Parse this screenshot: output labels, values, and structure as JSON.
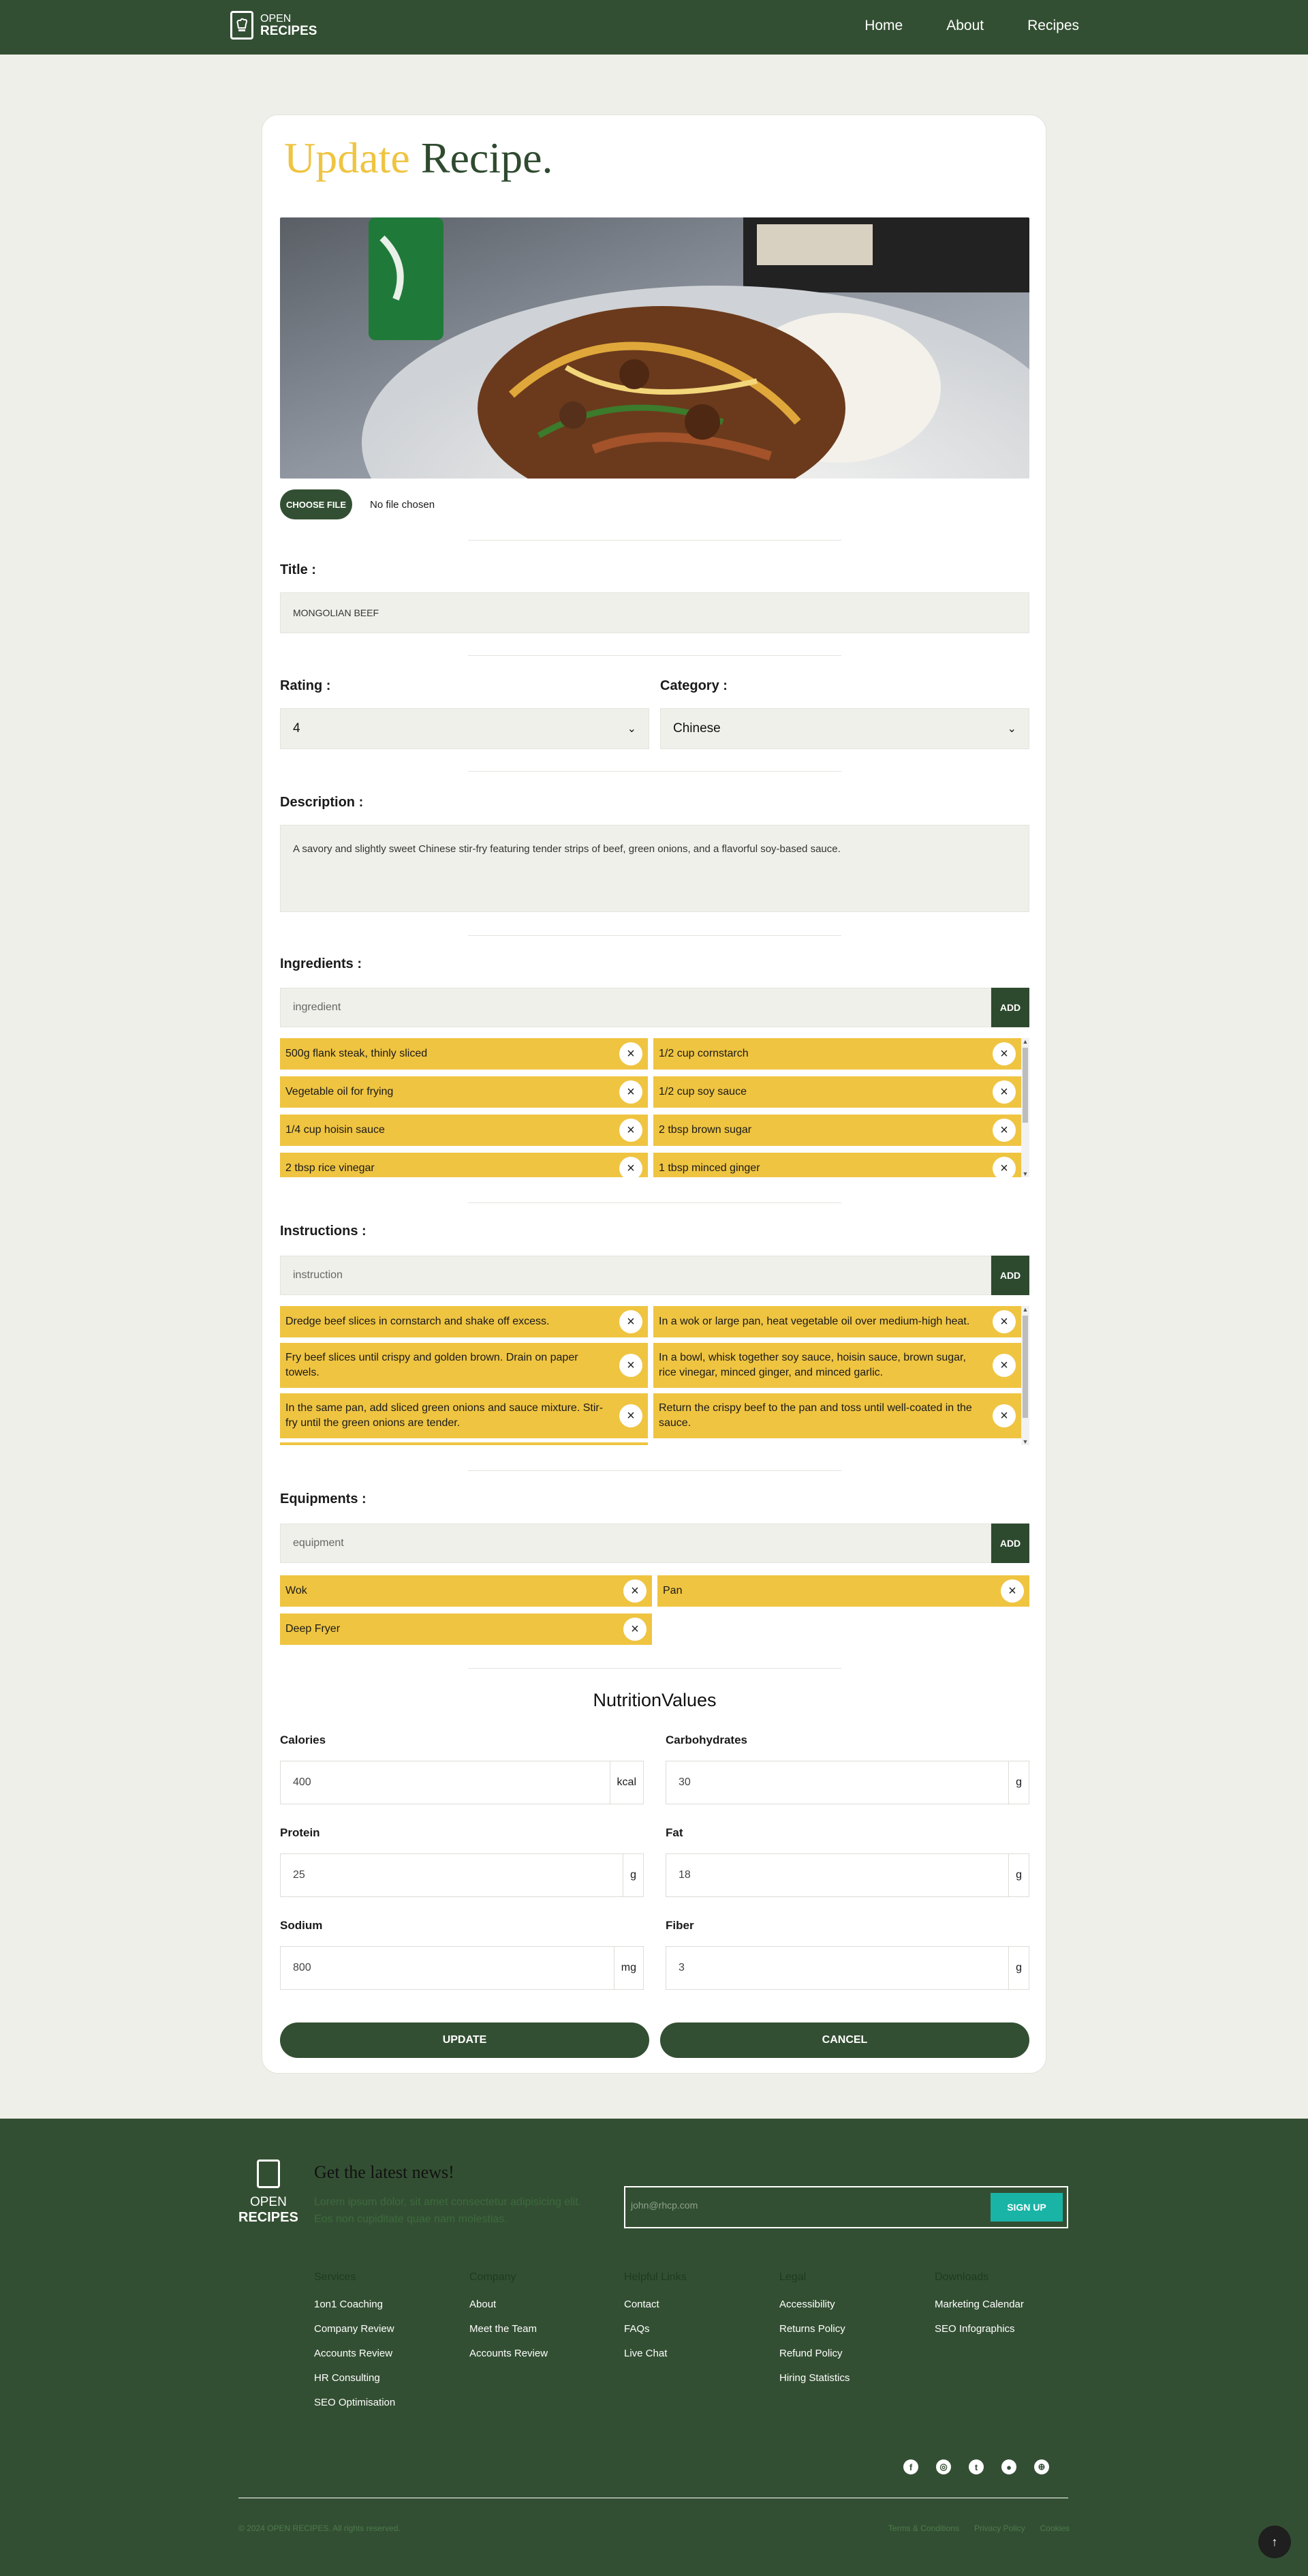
{
  "brand": {
    "line1": "OPEN",
    "line2": "RECIPES"
  },
  "nav": {
    "items": [
      "Home",
      "About",
      "Recipes"
    ]
  },
  "heading": {
    "word1": "Update",
    "word2": "Recipe."
  },
  "file": {
    "button_label": "CHOOSE FILE",
    "status": "No file chosen"
  },
  "title_field": {
    "label": "Title :",
    "value": "MONGOLIAN BEEF"
  },
  "rating": {
    "label": "Rating :",
    "value": "4"
  },
  "category": {
    "label": "Category :",
    "value": "Chinese"
  },
  "description": {
    "label": "Description :",
    "value": "A savory and slightly sweet Chinese stir-fry featuring tender strips of beef, green onions, and a flavorful soy-based sauce."
  },
  "ingredients": {
    "label": "Ingredients :",
    "placeholder": "ingredient",
    "add_label": "ADD",
    "items": [
      "500g flank steak, thinly sliced",
      "1/2 cup cornstarch",
      "Vegetable oil for frying",
      "1/2 cup soy sauce",
      "1/4 cup hoisin sauce",
      "2 tbsp brown sugar",
      "2 tbsp rice vinegar",
      "1 tbsp minced ginger"
    ]
  },
  "instructions": {
    "label": "Instructions :",
    "placeholder": "instruction",
    "add_label": "ADD",
    "items": [
      "Dredge beef slices in cornstarch and shake off excess.",
      "In a wok or large pan, heat vegetable oil over medium-high heat.",
      "Fry beef slices until crispy and golden brown. Drain on paper towels.",
      "In a bowl, whisk together soy sauce, hoisin sauce, brown sugar, rice vinegar, minced ginger, and minced garlic.",
      "In the same pan, add sliced green onions and sauce mixture. Stir-fry until the green onions are tender.",
      "Return the crispy beef to the pan and toss until well-coated in the sauce."
    ]
  },
  "equipments": {
    "label": "Equipments :",
    "placeholder": "equipment",
    "add_label": "ADD",
    "items": [
      "Wok",
      "Pan",
      "Deep Fryer"
    ]
  },
  "nutrition": {
    "title": "NutritionValues",
    "calories": {
      "label": "Calories",
      "value": "400",
      "unit": "kcal"
    },
    "carbohydrates": {
      "label": "Carbohydrates",
      "value": "30",
      "unit": "g"
    },
    "protein": {
      "label": "Protein",
      "value": "25",
      "unit": "g"
    },
    "fat": {
      "label": "Fat",
      "value": "18",
      "unit": "g"
    },
    "sodium": {
      "label": "Sodium",
      "value": "800",
      "unit": "mg"
    },
    "fiber": {
      "label": "Fiber",
      "value": "3",
      "unit": "g"
    }
  },
  "actions": {
    "update": "UPDATE",
    "cancel": "CANCEL"
  },
  "footer": {
    "brand_line1": "OPEN",
    "brand_line2": "RECIPES",
    "news_title": "Get the latest news!",
    "news_text": "Lorem ipsum dolor, sit amet consectetur adipisicing elit. Eos non cupiditate quae nam molestias.",
    "email_placeholder": "john@rhcp.com",
    "signup_label": "SIGN UP",
    "columns": [
      {
        "heading": "Services",
        "items": [
          "1on1 Coaching",
          "Company Review",
          "Accounts Review",
          "HR Consulting",
          "SEO Optimisation"
        ]
      },
      {
        "heading": "Company",
        "items": [
          "About",
          "Meet the Team",
          "Accounts Review"
        ]
      },
      {
        "heading": "Helpful Links",
        "items": [
          "Contact",
          "FAQs",
          "Live Chat"
        ]
      },
      {
        "heading": "Legal",
        "items": [
          "Accessibility",
          "Returns Policy",
          "Refund Policy",
          "Hiring Statistics"
        ]
      },
      {
        "heading": "Downloads",
        "items": [
          "Marketing Calendar",
          "SEO Infographics"
        ]
      }
    ],
    "copyright": "© 2024 OPEN RECIPES. All rights reserved.",
    "legal_links": [
      "Terms & Conditions",
      "Privacy Policy",
      "Cookies"
    ],
    "socials": [
      "facebook-icon",
      "instagram-icon",
      "twitter-icon",
      "github-icon",
      "dribbble-icon"
    ]
  },
  "colors": {
    "brand_green": "#334f33",
    "accent_yellow": "#efc441",
    "signup_teal": "#19b4a6"
  }
}
